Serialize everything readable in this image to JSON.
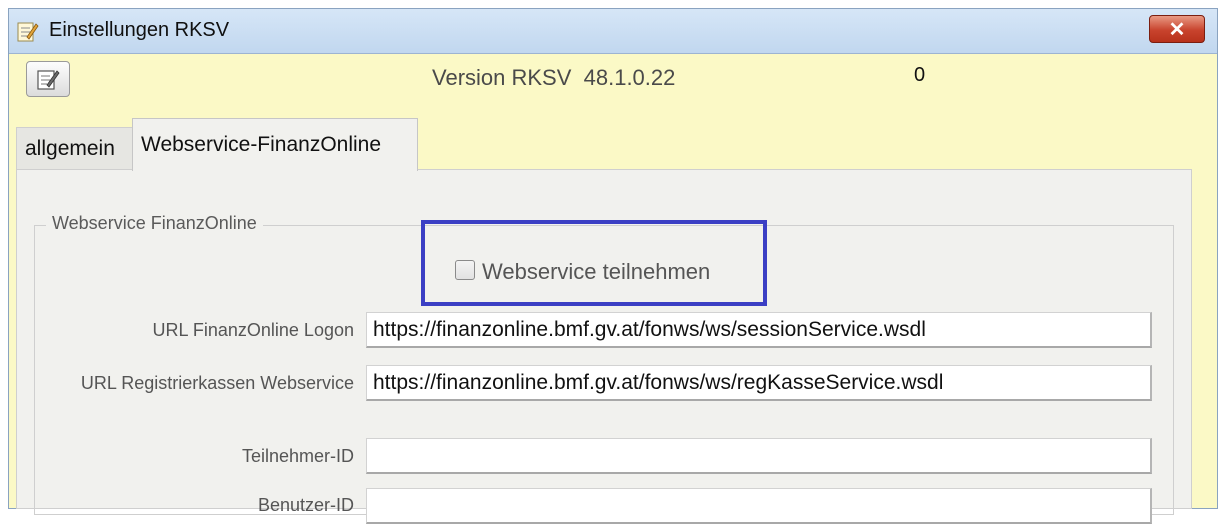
{
  "window": {
    "title": "Einstellungen RKSV",
    "close_label": "✕"
  },
  "header": {
    "version_text": "Version RKSV  48.1.0.22",
    "counter": "0"
  },
  "tabs": [
    {
      "label": "allgemein",
      "active": false
    },
    {
      "label": "Webservice-FinanzOnline",
      "active": true
    }
  ],
  "group": {
    "legend": "Webservice FinanzOnline",
    "checkbox_label": "Webservice teilnehmen",
    "checkbox_checked": false,
    "highlight_color": "#3b3fc4"
  },
  "fields": [
    {
      "label": "URL FinanzOnline Logon",
      "value": "https://finanzonline.bmf.gv.at/fonws/ws/sessionService.wsdl"
    },
    {
      "label": "URL Registrierkassen Webservice",
      "value": "https://finanzonline.bmf.gv.at/fonws/ws/regKasseService.wsdl"
    },
    {
      "label": "Teilnehmer-ID",
      "value": ""
    },
    {
      "label": "Benutzer-ID",
      "value": ""
    }
  ]
}
